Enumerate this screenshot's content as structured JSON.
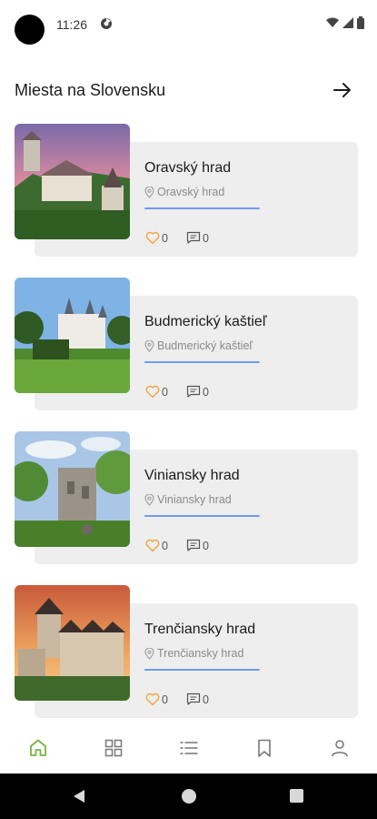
{
  "status_bar": {
    "time": "11:26"
  },
  "header": {
    "title": "Miesta na Slovensku"
  },
  "places": [
    {
      "name": "Oravský hrad",
      "location": "Oravský hrad",
      "likes": "0",
      "comments": "0"
    },
    {
      "name": "Budmerický kaštieľ",
      "location": "Budmerický kaštieľ",
      "likes": "0",
      "comments": "0"
    },
    {
      "name": "Viniansky hrad",
      "location": "Viniansky hrad",
      "likes": "0",
      "comments": "0"
    },
    {
      "name": "Trenčiansky hrad",
      "location": "Trenčiansky hrad",
      "likes": "0",
      "comments": "0"
    }
  ],
  "bottom_nav": {
    "active": "home",
    "items": [
      "home-icon",
      "grid-icon",
      "list-icon",
      "bookmark-icon",
      "profile-icon"
    ]
  },
  "colors": {
    "accent_green": "#7cb342",
    "line_blue": "#6f9af2",
    "heart_orange": "#f0a33a",
    "card_bg": "#eeeeee"
  }
}
